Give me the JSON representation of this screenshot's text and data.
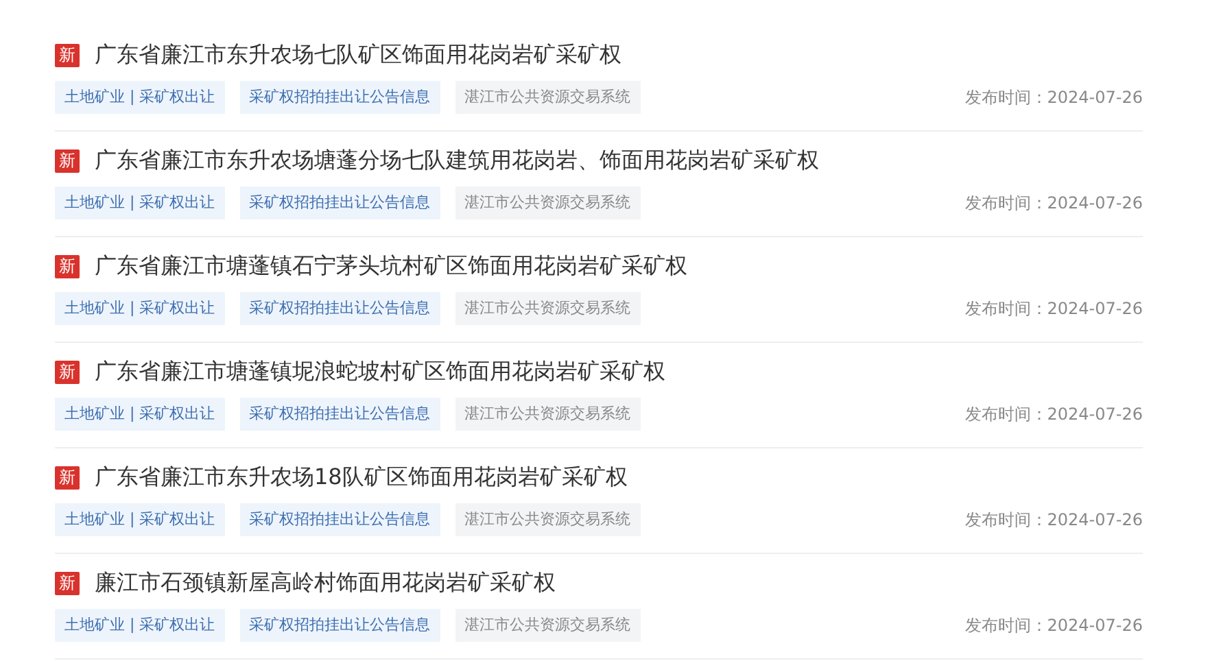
{
  "items": [
    {
      "badge": "新",
      "title": "广东省廉江市东升农场七队矿区饰面用花岗岩矿采矿权",
      "tags": [
        {
          "kind": "category",
          "text": "土地矿业 | 采矿权出让"
        },
        {
          "kind": "category",
          "text": "采矿权招拍挂出让公告信息"
        },
        {
          "kind": "source",
          "text": "湛江市公共资源交易系统"
        }
      ],
      "date": "发布时间：2024-07-26"
    },
    {
      "badge": "新",
      "title": "广东省廉江市东升农场塘蓬分场七队建筑用花岗岩、饰面用花岗岩矿采矿权",
      "tags": [
        {
          "kind": "category",
          "text": "土地矿业 | 采矿权出让"
        },
        {
          "kind": "category",
          "text": "采矿权招拍挂出让公告信息"
        },
        {
          "kind": "source",
          "text": "湛江市公共资源交易系统"
        }
      ],
      "date": "发布时间：2024-07-26"
    },
    {
      "badge": "新",
      "title": "广东省廉江市塘蓬镇石宁茅头坑村矿区饰面用花岗岩矿采矿权",
      "tags": [
        {
          "kind": "category",
          "text": "土地矿业 | 采矿权出让"
        },
        {
          "kind": "category",
          "text": "采矿权招拍挂出让公告信息"
        },
        {
          "kind": "source",
          "text": "湛江市公共资源交易系统"
        }
      ],
      "date": "发布时间：2024-07-26"
    },
    {
      "badge": "新",
      "title": "广东省廉江市塘蓬镇坭浪蛇坡村矿区饰面用花岗岩矿采矿权",
      "tags": [
        {
          "kind": "category",
          "text": "土地矿业 | 采矿权出让"
        },
        {
          "kind": "category",
          "text": "采矿权招拍挂出让公告信息"
        },
        {
          "kind": "source",
          "text": "湛江市公共资源交易系统"
        }
      ],
      "date": "发布时间：2024-07-26"
    },
    {
      "badge": "新",
      "title": "广东省廉江市东升农场18队矿区饰面用花岗岩矿采矿权",
      "tags": [
        {
          "kind": "category",
          "text": "土地矿业 | 采矿权出让"
        },
        {
          "kind": "category",
          "text": "采矿权招拍挂出让公告信息"
        },
        {
          "kind": "source",
          "text": "湛江市公共资源交易系统"
        }
      ],
      "date": "发布时间：2024-07-26"
    },
    {
      "badge": "新",
      "title": "廉江市石颈镇新屋高岭村饰面用花岗岩矿采矿权",
      "tags": [
        {
          "kind": "category",
          "text": "土地矿业 | 采矿权出让"
        },
        {
          "kind": "category",
          "text": "采矿权招拍挂出让公告信息"
        },
        {
          "kind": "source",
          "text": "湛江市公共资源交易系统"
        }
      ],
      "date": "发布时间：2024-07-26"
    }
  ]
}
